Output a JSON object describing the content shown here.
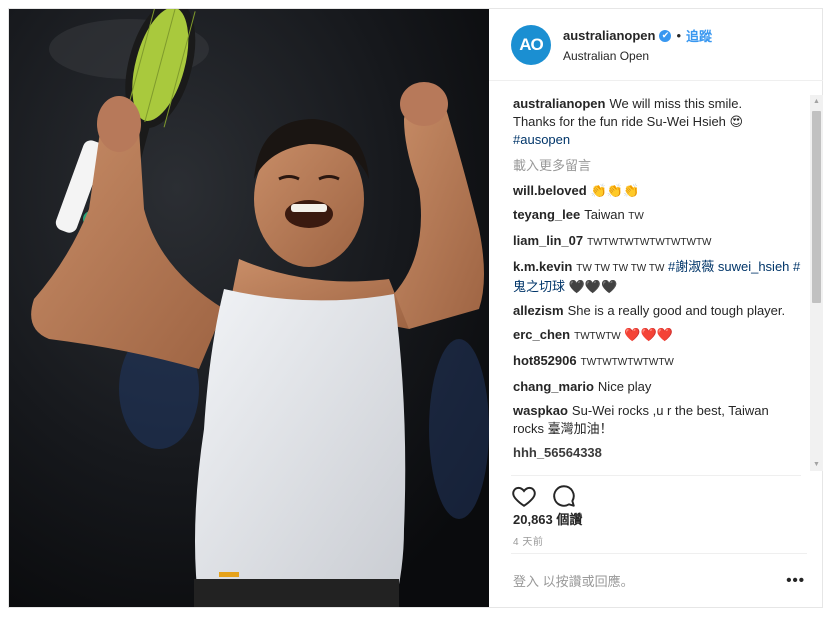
{
  "account": {
    "avatar_text": "AO",
    "username": "australianopen",
    "verified_symbol": "✔",
    "separator": "•",
    "follow_label": "追蹤",
    "location": "Australian Open"
  },
  "caption": {
    "user": "australianopen",
    "text_line1": "We will miss this smile.",
    "text_line2": "Thanks for the fun ride Su-Wei Hsieh 😍",
    "hashtag": "#ausopen"
  },
  "load_more_label": "載入更多留言",
  "comments": [
    {
      "user": "will.beloved",
      "text": "👏👏👏"
    },
    {
      "user": "teyang_lee",
      "text": "Taiwan",
      "small": "TW"
    },
    {
      "user": "liam_lin_07",
      "small": "TWTWTWTWTWTWTWTW"
    },
    {
      "user": "k.m.kevin",
      "small": "TW TW TW TW TW",
      "tag": "#謝淑薇 suwei_hsieh #鬼之切球",
      "hearts": "🖤🖤🖤"
    },
    {
      "user": "allezism",
      "text": "She is a really good and tough player."
    },
    {
      "user": "erc_chen",
      "small": "TWTWTW",
      "hearts": "❤️❤️❤️"
    },
    {
      "user": "hot852906",
      "small": "TWTWTWTWTWTW"
    },
    {
      "user": "chang_mario",
      "text": "Nice play"
    },
    {
      "user": "waspkao",
      "text": "Su-Wei rocks ,u r the best, Taiwan rocks 臺灣加油！"
    },
    {
      "user": "hhh_56564338",
      "text": ""
    }
  ],
  "likes": "20,863 個讚",
  "time": "4 天前",
  "add_comment_placeholder": "登入 以按讚或回應。",
  "more_options": "•••",
  "icons": {
    "like": "heart-outline-icon",
    "comment": "speech-bubble-icon",
    "verified": "verified-badge-icon",
    "more": "more-options-icon"
  },
  "colors": {
    "accent": "#3897f0",
    "avatar": "#1b8fd2",
    "muted": "#999999",
    "text": "#262626"
  }
}
